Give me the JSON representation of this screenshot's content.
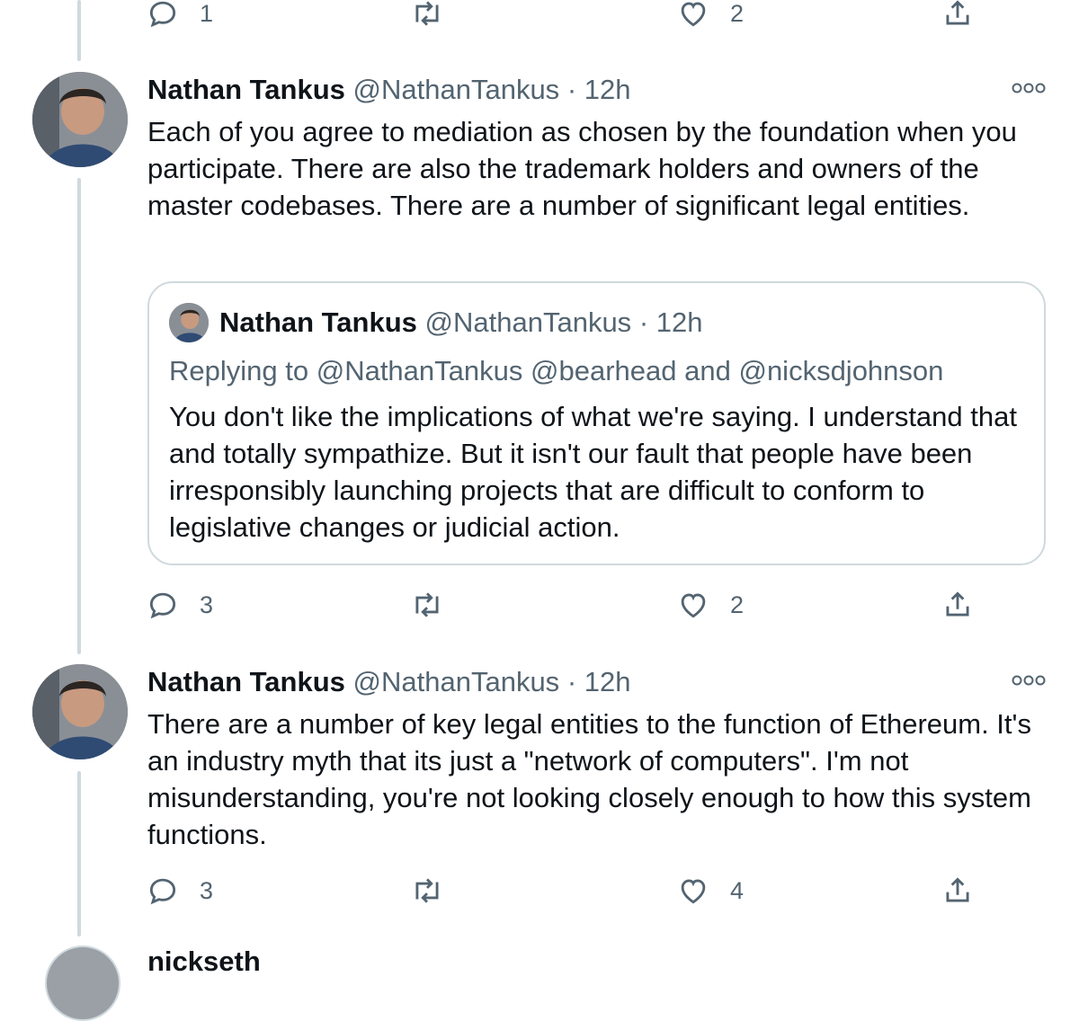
{
  "top_actions": {
    "reply_count": "1",
    "retweet_count": "",
    "like_count": "2"
  },
  "tweets": [
    {
      "name": "Nathan Tankus",
      "handle": "@NathanTankus",
      "dot": "·",
      "time": "12h",
      "text": "Each of you agree to mediation as chosen by the foundation when you participate. There are also the trademark holders and owners of the master codebases. There are a number of significant legal entities.",
      "quote": {
        "name": "Nathan Tankus",
        "handle": "@NathanTankus",
        "dot": "·",
        "time": "12h",
        "replying_prefix": "Replying to",
        "replying_mention_1": "@NathanTankus",
        "replying_mention_2": "@bearhead",
        "replying_and": "and",
        "replying_mention_3": "@nicksdjohnson",
        "text": "You don't like the implications of what we're saying. I understand that and totally sympathize. But it isn't our fault that people have been irresponsibly launching projects that are difficult to conform to legislative changes or judicial action."
      },
      "reply_count": "3",
      "like_count": "2"
    },
    {
      "name": "Nathan Tankus",
      "handle": "@NathanTankus",
      "dot": "·",
      "time": "12h",
      "text": "There are a number of key legal entities to the function of Ethereum. It's an industry myth that its just a \"network of computers\". I'm not misunderstanding, you're not looking closely enough to how this system functions.",
      "reply_count": "3",
      "like_count": "4"
    }
  ],
  "partial_next": {
    "name": "nickseth"
  },
  "icons": {
    "reply": "speech-bubble-icon",
    "retweet": "retweet-icon",
    "like": "heart-icon",
    "share": "share-icon",
    "more": "more-icon"
  },
  "colors": {
    "text": "#0f1419",
    "muted": "#536471",
    "border": "#cfd9de"
  }
}
